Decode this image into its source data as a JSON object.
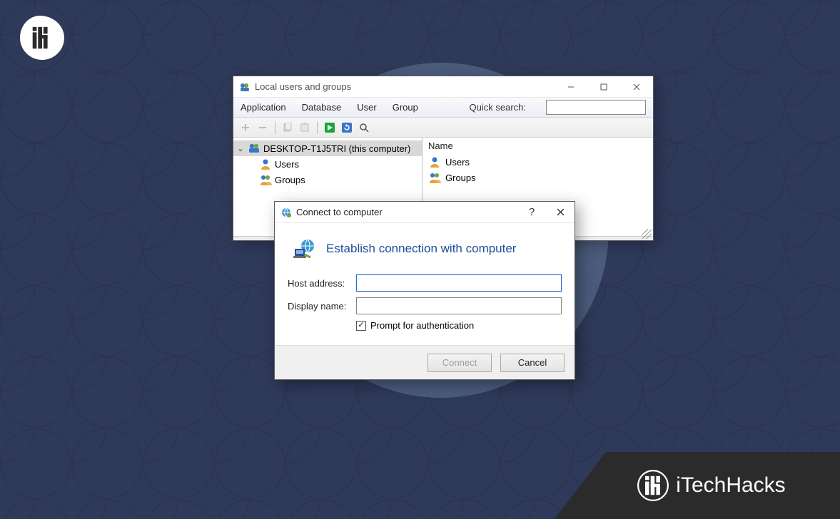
{
  "brand": {
    "name": "iTechHacks"
  },
  "window": {
    "title": "Local users and groups",
    "menu": {
      "application": "Application",
      "database": "Database",
      "user": "User",
      "group": "Group"
    },
    "quick_search_label": "Quick search:",
    "quick_search_value": "",
    "tree": {
      "root": "DESKTOP-T1J5TRI (this computer)",
      "children": {
        "users": "Users",
        "groups": "Groups"
      }
    },
    "list": {
      "header_name": "Name",
      "rows": {
        "users": "Users",
        "groups": "Groups"
      }
    }
  },
  "dialog": {
    "title": "Connect to computer",
    "heading": "Establish connection with computer",
    "host_label": "Host address:",
    "host_value": "",
    "display_label": "Display name:",
    "display_value": "",
    "prompt_label": "Prompt for authentication",
    "prompt_checked": true,
    "connect": "Connect",
    "cancel": "Cancel"
  }
}
